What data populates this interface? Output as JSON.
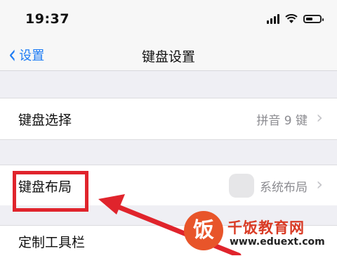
{
  "status_bar": {
    "time": "19:37"
  },
  "nav": {
    "back_label": "设置",
    "title": "键盘设置"
  },
  "rows": [
    {
      "label": "键盘选择",
      "value": "拼音 9 键"
    },
    {
      "label": "键盘布局",
      "value": "系统布局"
    },
    {
      "label": "定制工具栏"
    }
  ],
  "watermark": {
    "logo_char": "饭",
    "name": "千饭教育网",
    "url": "www.eduext.com"
  },
  "colors": {
    "accent": "#1e7cf4",
    "highlight": "#e0242c",
    "background": "#efeff4"
  },
  "icons": [
    "wifi-icon",
    "signal-icon",
    "battery-icon",
    "chevron-left-icon",
    "chevron-right-icon"
  ]
}
